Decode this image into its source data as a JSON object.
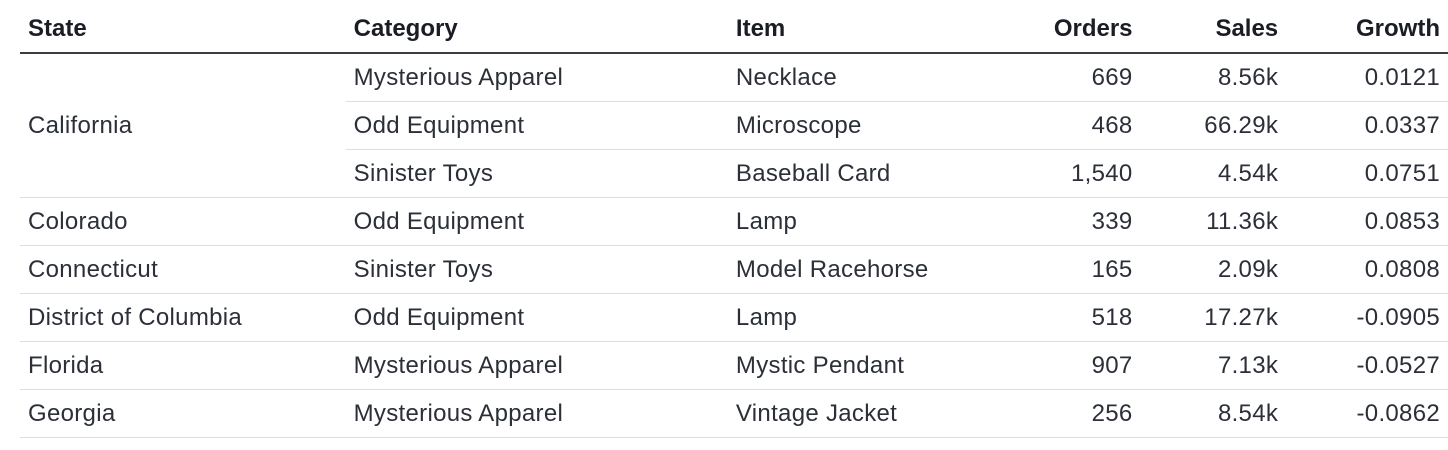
{
  "table": {
    "headers": {
      "state": "State",
      "category": "Category",
      "item": "Item",
      "orders": "Orders",
      "sales": "Sales",
      "growth": "Growth"
    },
    "groups": [
      {
        "state": "California",
        "rows": [
          {
            "category": "Mysterious Apparel",
            "item": "Necklace",
            "orders": "669",
            "sales": "8.56k",
            "growth": "0.0121"
          },
          {
            "category": "Odd Equipment",
            "item": "Microscope",
            "orders": "468",
            "sales": "66.29k",
            "growth": "0.0337"
          },
          {
            "category": "Sinister Toys",
            "item": "Baseball Card",
            "orders": "1,540",
            "sales": "4.54k",
            "growth": "0.0751"
          }
        ]
      },
      {
        "state": "Colorado",
        "rows": [
          {
            "category": "Odd Equipment",
            "item": "Lamp",
            "orders": "339",
            "sales": "11.36k",
            "growth": "0.0853"
          }
        ]
      },
      {
        "state": "Connecticut",
        "rows": [
          {
            "category": "Sinister Toys",
            "item": "Model Racehorse",
            "orders": "165",
            "sales": "2.09k",
            "growth": "0.0808"
          }
        ]
      },
      {
        "state": "District of Columbia",
        "rows": [
          {
            "category": "Odd Equipment",
            "item": "Lamp",
            "orders": "518",
            "sales": "17.27k",
            "growth": "-0.0905"
          }
        ]
      },
      {
        "state": "Florida",
        "rows": [
          {
            "category": "Mysterious Apparel",
            "item": "Mystic Pendant",
            "orders": "907",
            "sales": "7.13k",
            "growth": "-0.0527"
          }
        ]
      },
      {
        "state": "Georgia",
        "rows": [
          {
            "category": "Mysterious Apparel",
            "item": "Vintage Jacket",
            "orders": "256",
            "sales": "8.54k",
            "growth": "-0.0862"
          }
        ]
      }
    ]
  }
}
